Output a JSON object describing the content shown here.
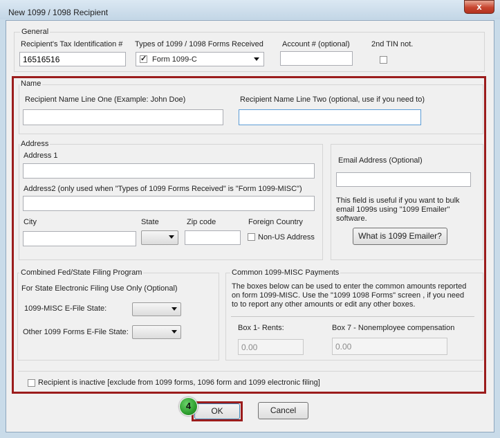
{
  "window": {
    "title": "New 1099 / 1098 Recipient",
    "close_label": "x"
  },
  "general": {
    "legend": "General",
    "tin_label": "Recipient's Tax Identification #",
    "tin_value": "16516516",
    "forms_label": "Types of 1099 / 1098 Forms Received",
    "forms_value": "Form 1099-C",
    "forms_checked": true,
    "account_label": "Account # (optional)",
    "account_value": "",
    "tin_notice_label": "2nd TIN not."
  },
  "name": {
    "legend": "Name",
    "line1_label": "Recipient Name Line One (Example: John Doe)",
    "line1_value": "",
    "line2_label": "Recipient Name Line Two (optional, use if you need to)",
    "line2_value": ""
  },
  "address": {
    "legend": "Address",
    "address1_label": "Address 1",
    "address2_label": "Address2 (only used when \"Types of 1099 Forms Received\" is \"Form 1099-MISC\")",
    "city_label": "City",
    "state_label": "State",
    "zip_label": "Zip code",
    "foreign_label": "Foreign Country",
    "non_us_label": "Non-US Address"
  },
  "email": {
    "label": "Email Address (Optional)",
    "help": "This field is useful if you want to bulk email 1099s using \"1099 Emailer\" software.",
    "button": "What is 1099 Emailer?"
  },
  "state_filing": {
    "legend": "Combined Fed/State Filing Program",
    "subtitle": "For State Electronic Filing Use Only (Optional)",
    "misc_label": "1099-MISC E-File State:",
    "other_label": "Other 1099 Forms E-File State:"
  },
  "payments": {
    "legend": "Common 1099-MISC Payments",
    "help": "The boxes below can be used to enter the common amounts reported on form 1099-MISC. Use the \"1099  1098 Forms\" screen , if you need to to report any other amounts or edit any other boxes.",
    "box1_label": "Box 1- Rents:",
    "box1_value": "0.00",
    "box7_label": "Box 7 - Nonemployee compensation",
    "box7_value": "0.00"
  },
  "inactive_label": "Recipient is inactive [exclude from 1099 forms, 1096 form and 1099 electronic filing]",
  "buttons": {
    "ok": "OK",
    "cancel": "Cancel"
  },
  "step_badge": "4",
  "colors": {
    "highlight": "#9b1c1c",
    "badge": "#2e9e2e"
  }
}
